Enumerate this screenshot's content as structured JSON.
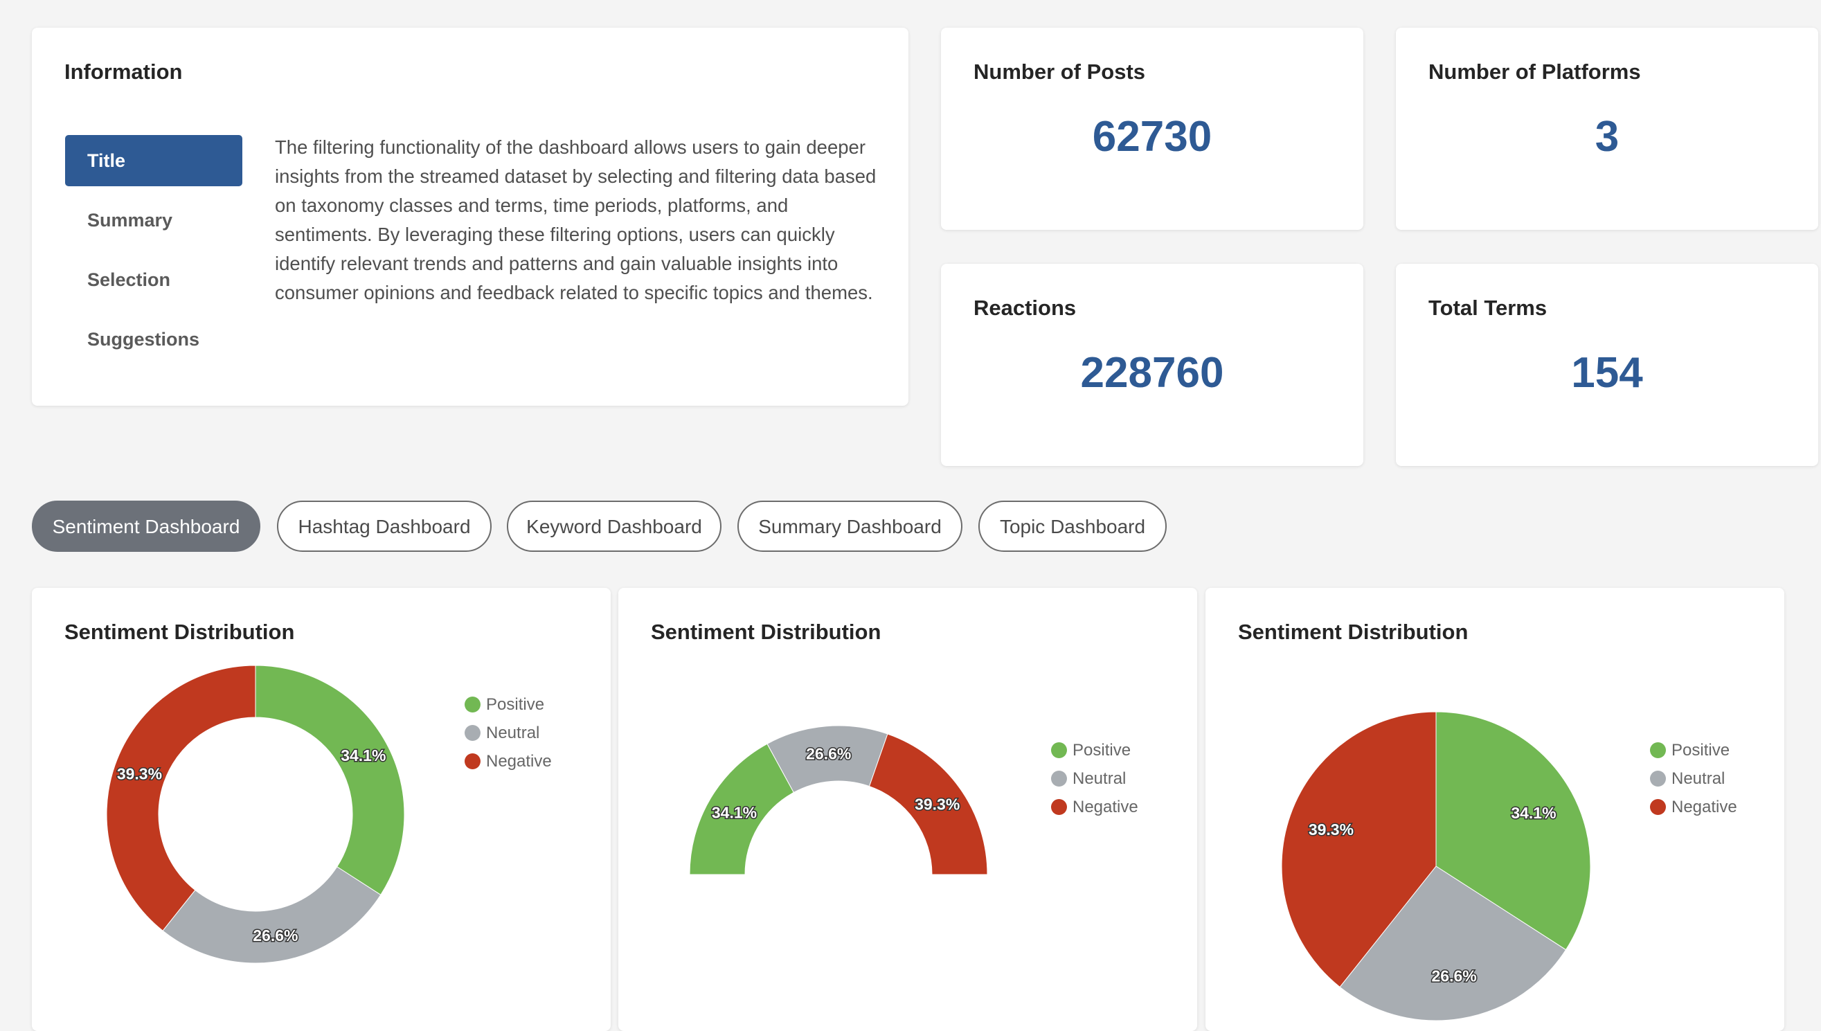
{
  "info": {
    "title": "Information",
    "nav": [
      {
        "label": "Title",
        "active": true
      },
      {
        "label": "Summary",
        "active": false
      },
      {
        "label": "Selection",
        "active": false
      },
      {
        "label": "Suggestions",
        "active": false
      }
    ],
    "text": "The filtering functionality of the dashboard allows users to gain deeper insights from the streamed dataset by selecting and filtering data based on taxonomy classes and terms, time periods, platforms, and sentiments. By leveraging these filtering options, users can quickly identify relevant trends and patterns and gain valuable insights into consumer opinions and feedback related to specific topics and themes."
  },
  "metrics": {
    "posts": {
      "label": "Number of Posts",
      "value": "62730"
    },
    "platforms": {
      "label": "Number of Platforms",
      "value": "3"
    },
    "reactions": {
      "label": "Reactions",
      "value": "228760"
    },
    "terms": {
      "label": "Total Terms",
      "value": "154"
    }
  },
  "tabs": [
    {
      "label": "Sentiment Dashboard",
      "active": true
    },
    {
      "label": "Hashtag Dashboard",
      "active": false
    },
    {
      "label": "Keyword Dashboard",
      "active": false
    },
    {
      "label": "Summary Dashboard",
      "active": false
    },
    {
      "label": "Topic Dashboard",
      "active": false
    }
  ],
  "colors": {
    "accent": "#2e5a94",
    "positive": "#72b853",
    "neutral": "#a8adb2",
    "negative": "#c0391f"
  },
  "chart_data": [
    {
      "type": "pie",
      "variant": "donut",
      "title": "Sentiment Distribution",
      "categories": [
        "Positive",
        "Neutral",
        "Negative"
      ],
      "values": [
        34.1,
        26.6,
        39.3
      ],
      "value_labels": [
        "34.1%",
        "26.6%",
        "39.3%"
      ],
      "colors": [
        "#72b853",
        "#a8adb2",
        "#c0391f"
      ],
      "legend": "right"
    },
    {
      "type": "pie",
      "variant": "semi-donut",
      "title": "Sentiment Distribution",
      "categories": [
        "Positive",
        "Neutral",
        "Negative"
      ],
      "values": [
        34.1,
        26.6,
        39.3
      ],
      "value_labels": [
        "34.1%",
        "26.6%",
        "39.3%"
      ],
      "colors": [
        "#72b853",
        "#a8adb2",
        "#c0391f"
      ],
      "legend": "right"
    },
    {
      "type": "pie",
      "variant": "pie",
      "title": "Sentiment Distribution",
      "categories": [
        "Positive",
        "Neutral",
        "Negative"
      ],
      "values": [
        34.1,
        26.6,
        39.3
      ],
      "value_labels": [
        "34.1%",
        "26.6%",
        "39.3%"
      ],
      "colors": [
        "#72b853",
        "#a8adb2",
        "#c0391f"
      ],
      "legend": "right"
    }
  ]
}
